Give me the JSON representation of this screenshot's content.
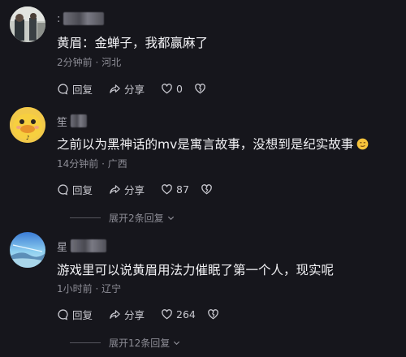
{
  "comments": [
    {
      "name_visible": ":",
      "text": "黄眉：金蝉子，我都赢麻了",
      "meta": "2分钟前 · 河北",
      "reply_label": "回复",
      "share_label": "分享",
      "like_count": "0"
    },
    {
      "name_visible": "笙",
      "text": "之前以为黑神话的mv是寓言故事，没想到是纪实故事",
      "emoji_icon": "smirk-emoji-icon",
      "meta": "14分钟前 · 广西",
      "reply_label": "回复",
      "share_label": "分享",
      "like_count": "87",
      "expand_label": "展开2条回复"
    },
    {
      "name_visible": "星",
      "text": "游戏里可以说黄眉用法力催眠了第一个人，现实呢",
      "meta": "1小时前 · 辽宁",
      "reply_label": "回复",
      "share_label": "分享",
      "like_count": "264",
      "expand_label": "展开12条回复"
    }
  ],
  "colors": {
    "background": "#16161c",
    "text": "#f2f2f5",
    "meta": "#8d8d96"
  }
}
